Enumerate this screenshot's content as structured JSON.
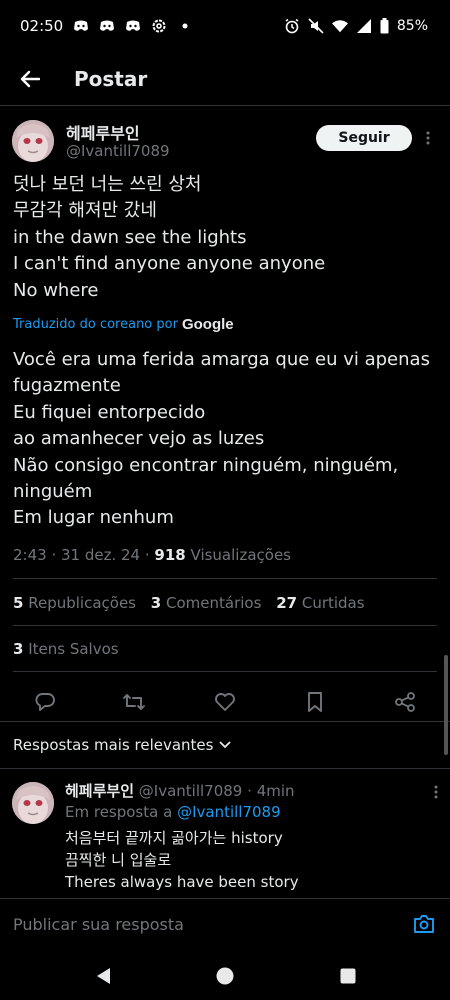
{
  "status_bar": {
    "time": "02:50",
    "battery": "85%",
    "icons": [
      "discord-icon",
      "discord-icon",
      "discord-icon",
      "settings-icon",
      "dot-icon",
      "alarm-icon",
      "mute-icon",
      "wifi-icon",
      "signal-icon",
      "battery-icon"
    ]
  },
  "header": {
    "title": "Postar"
  },
  "tweet": {
    "author_name": "헤페루부인",
    "author_handle": "@Ivantill7089",
    "follow_label": "Seguir",
    "original_lines": [
      "덧나 보던 너는 쓰린 상처",
      "무감각 해져만 갔네",
      "in the dawn see the lights",
      "I can't find anyone anyone anyone",
      "No where"
    ],
    "translated_by_label": "Traduzido do coreano por",
    "translator": "Google",
    "translated_lines": [
      "Você era uma ferida amarga que eu vi apenas fugazmente",
      "Eu fiquei entorpecido",
      "ao amanhecer vejo as luzes",
      "Não consigo encontrar ninguém, ninguém, ninguém",
      "Em lugar nenhum"
    ],
    "time": "2:43",
    "date": "31 dez. 24",
    "views_count": "918",
    "views_label": "Visualizações",
    "reposts_count": "5",
    "reposts_label": "Republicações",
    "comments_count": "3",
    "comments_label": "Comentários",
    "likes_count": "27",
    "likes_label": "Curtidas",
    "saves_count": "3",
    "saves_label": "Itens Salvos"
  },
  "replies_sort_label": "Respostas mais relevantes",
  "reply": {
    "author_name": "헤페루부인",
    "author_handle": "@Ivantill7089",
    "time_ago": "4min",
    "reply_to_label": "Em resposta a",
    "reply_to_handle": "@Ivantill7089",
    "lines": [
      "처음부터 끝까지 곪아가는 history",
      "끔찍한 니 입술로",
      "Theres always have been story"
    ]
  },
  "composer": {
    "placeholder": "Publicar sua resposta"
  },
  "colors": {
    "accent": "#1d9bf0",
    "background": "#000000",
    "muted": "#71767b",
    "text": "#e7e9ea"
  }
}
